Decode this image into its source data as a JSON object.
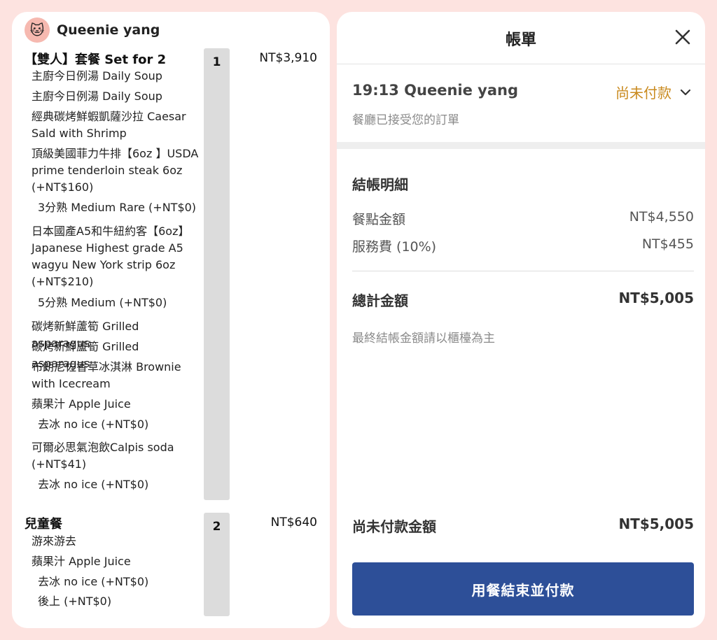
{
  "user": {
    "name": "Queenie yang",
    "avatar_icon": "cat-face-icon"
  },
  "orders": [
    {
      "title": "【雙人】套餐 Set for 2",
      "qty": "1",
      "price": "NT$3,910",
      "items": [
        "主廚今日例湯 Daily Soup",
        "主廚今日例湯 Daily Soup",
        "經典碳烤鮮蝦凱薩沙拉 Caesar Sald with Shrimp",
        "頂級美國菲力牛排【6oz 】USDA prime tenderloin steak 6oz (+NT$160)",
        "3分熟 Medium Rare (+NT$0)",
        "日本國產A5和牛紐約客【6oz】Japanese Highest grade A5 wagyu New York strip 6oz (+NT$210)",
        "5分熟 Medium (+NT$0)",
        "碳烤新鮮蘆筍 Grilled asparagus",
        "碳烤新鮮蘆筍 Grilled asparagus",
        "布朗尼佐香草冰淇淋 Brownie with Icecream",
        "蘋果汁 Apple Juice",
        "去冰 no ice (+NT$0)",
        "可爾必思氣泡飲Calpis soda (+NT$41)",
        "去冰 no ice (+NT$0)"
      ]
    },
    {
      "title": "兒童餐",
      "qty": "2",
      "price": "NT$640",
      "items": [
        "游來游去",
        "蘋果汁 Apple Juice",
        "去冰 no ice (+NT$0)",
        "後上 (+NT$0)"
      ]
    }
  ],
  "bill": {
    "title": "帳單",
    "order_time_name": "19:13 Queenie yang",
    "status": "尚未付款",
    "accepted_note": "餐廳已接受您的訂單",
    "section_title": "結帳明細",
    "subtotal_label": "餐點金額",
    "subtotal_value": "NT$4,550",
    "service_label": "服務費 (10%)",
    "service_value": "NT$455",
    "total_label": "總計金額",
    "total_value": "NT$5,005",
    "final_note": "最終結帳金額請以櫃檯為主",
    "unpaid_label": "尚未付款金額",
    "unpaid_value": "NT$5,005",
    "pay_button": "用餐結束並付款"
  },
  "colors": {
    "background": "#fde3e0",
    "status": "#c98a1e",
    "pay_button": "#2d4f98"
  }
}
